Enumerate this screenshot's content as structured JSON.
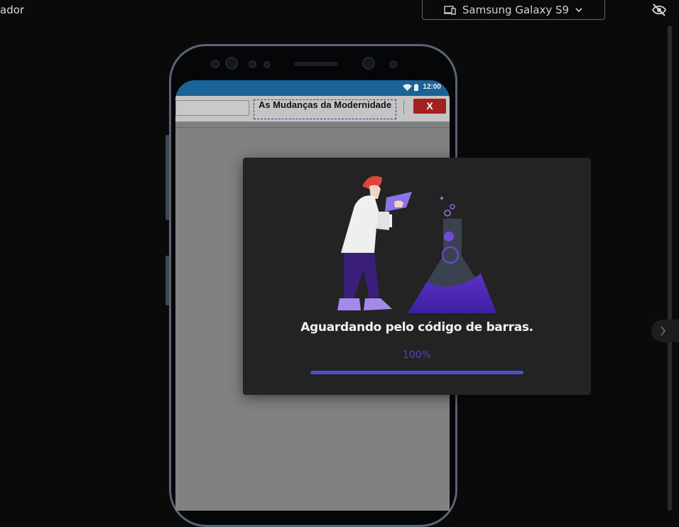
{
  "app": {
    "title": "ador"
  },
  "device_selector": {
    "value": "Samsung Galaxy S9",
    "icon": "device-icon",
    "chevron": "chevron-down-icon"
  },
  "visibility_toggle": {
    "icon": "eye-off-icon"
  },
  "phone": {
    "status_bar": {
      "time": "12:00"
    },
    "toolbar": {
      "title": "As Mudanças da Modernidade",
      "close_label": "X"
    }
  },
  "modal": {
    "message": "Aguardando pelo código de barras.",
    "progress_text": "100%",
    "progress_value": 1.0
  },
  "colors": {
    "accent": "#4a51c8",
    "percent": "#5b3fc4",
    "statusbar": "#1a6399",
    "close": "#a51f1f"
  }
}
